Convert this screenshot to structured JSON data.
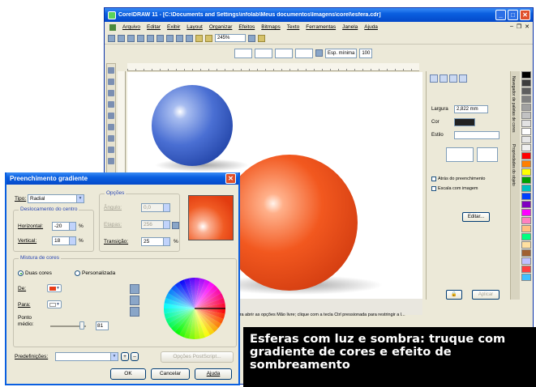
{
  "window": {
    "title": "CorelDRAW 11 - [C:\\Documents and Settings\\infolab\\Meus documentos\\Imagens\\corel\\esfera.cdr]"
  },
  "menubar": [
    "Arquivo",
    "Editar",
    "Exibir",
    "Layout",
    "Organizar",
    "Efeitos",
    "Bitmaps",
    "Texto",
    "Ferramentas",
    "Janela",
    "Ajuda"
  ],
  "toolbar": {
    "zoom": "245%",
    "outline_width": "Esp. mínima",
    "outline_value": "100"
  },
  "docker": {
    "tab_label": "Navegador de paletas de cores",
    "tab_label2": "Propriedades do objeto",
    "largura_label": "Largura",
    "largura_value": "2,822 mm",
    "cor_label": "Cor",
    "estilo_label": "Estilo",
    "atras_label": "Atrás do preenchimento",
    "escala_label": "Escala com imagem",
    "editar_label": "Editar...",
    "aplicar_label": "Aplicar"
  },
  "status_text": "Para abrir as opções Mão livre; clique com a tecla Ctrl pressionada para restringir a l...",
  "dialog": {
    "title": "Preenchimento gradiente",
    "tipo_label": "Tipo:",
    "tipo_value": "Radial",
    "offset_group": "Deslocamento do centro",
    "horizontal_label": "Horizontal:",
    "horizontal_value": "-20",
    "vertical_label": "Vertical:",
    "vertical_value": "18",
    "percent": "%",
    "options_group": "Opções",
    "angulo_label": "Ângulo:",
    "angulo_value": "0,0",
    "etapas_label": "Etapas:",
    "etapas_value": "256",
    "transicao_label": "Transição:",
    "transicao_value": "25",
    "mix_group": "Mistura de cores",
    "duas_cores_label": "Duas cores",
    "personalizada_label": "Personalizada",
    "de_label": "De:",
    "de_color": "#e83d17",
    "para_label": "Para:",
    "para_color": "#ffffff",
    "ponto_medio_label": "Ponto médio:",
    "ponto_medio_value": "81",
    "predefinicoes_label": "Predefinições:",
    "postscript_label": "Opções PostScript...",
    "ok_label": "OK",
    "cancelar_label": "Cancelar",
    "ajuda_label": "Ajuda"
  },
  "caption": "Esferas com luz e sombra: truque com gradiente de cores e efeito de sombreamento",
  "colors": {
    "blue_sphere": "#3c63c6",
    "orange_sphere": "#ee4a1c",
    "xp_blue": "#0a5fe0"
  },
  "palette": [
    "#000000",
    "#3d3d3d",
    "#5e5e5e",
    "#808080",
    "#a0a0a0",
    "#c2c2c2",
    "#e2e2e2",
    "#ffffff",
    "#e6e6e6",
    "#f0f0f0",
    "#ff0000",
    "#ff8000",
    "#ffff00",
    "#00a000",
    "#00c0c0",
    "#0040ff",
    "#8000c0",
    "#ff00ff",
    "#ff80c0",
    "#ffc080",
    "#00ff80",
    "#ffe0a0",
    "#a06030",
    "#c0c0ff",
    "#ff4040",
    "#40c0ff"
  ]
}
